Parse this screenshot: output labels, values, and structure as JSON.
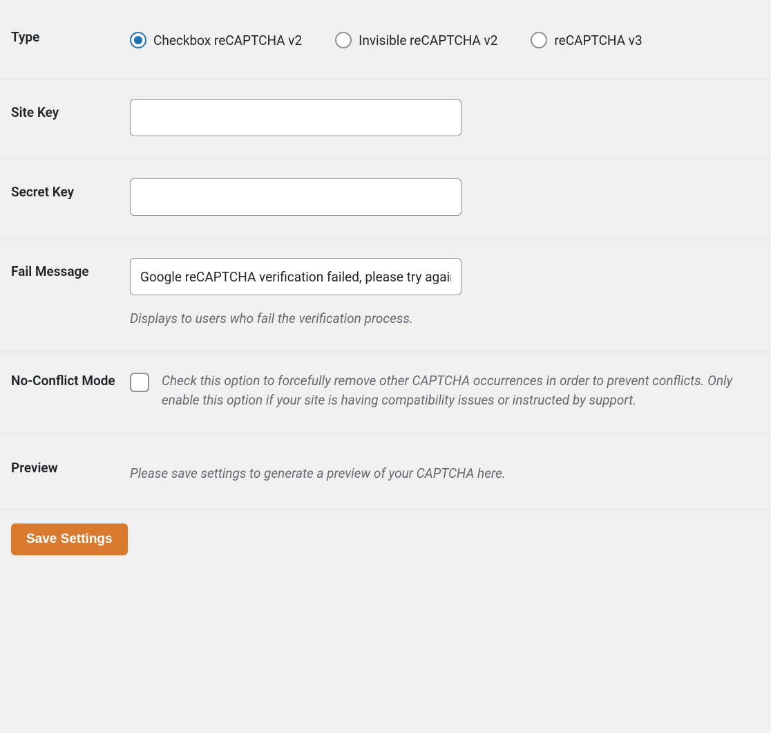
{
  "type": {
    "label": "Type",
    "options": [
      {
        "label": "Checkbox reCAPTCHA v2",
        "checked": true
      },
      {
        "label": "Invisible reCAPTCHA v2",
        "checked": false
      },
      {
        "label": "reCAPTCHA v3",
        "checked": false
      }
    ]
  },
  "site_key": {
    "label": "Site Key",
    "value": ""
  },
  "secret_key": {
    "label": "Secret Key",
    "value": ""
  },
  "fail_message": {
    "label": "Fail Message",
    "value": "Google reCAPTCHA verification failed, please try again later.",
    "description": "Displays to users who fail the verification process."
  },
  "no_conflict": {
    "label": "No-Conflict Mode",
    "description": "Check this option to forcefully remove other CAPTCHA occurrences in order to prevent conflicts. Only enable this option if your site is having compatibility issues or instructed by support.",
    "checked": false
  },
  "preview": {
    "label": "Preview",
    "text": "Please save settings to generate a preview of your CAPTCHA here."
  },
  "save_button": "Save Settings"
}
